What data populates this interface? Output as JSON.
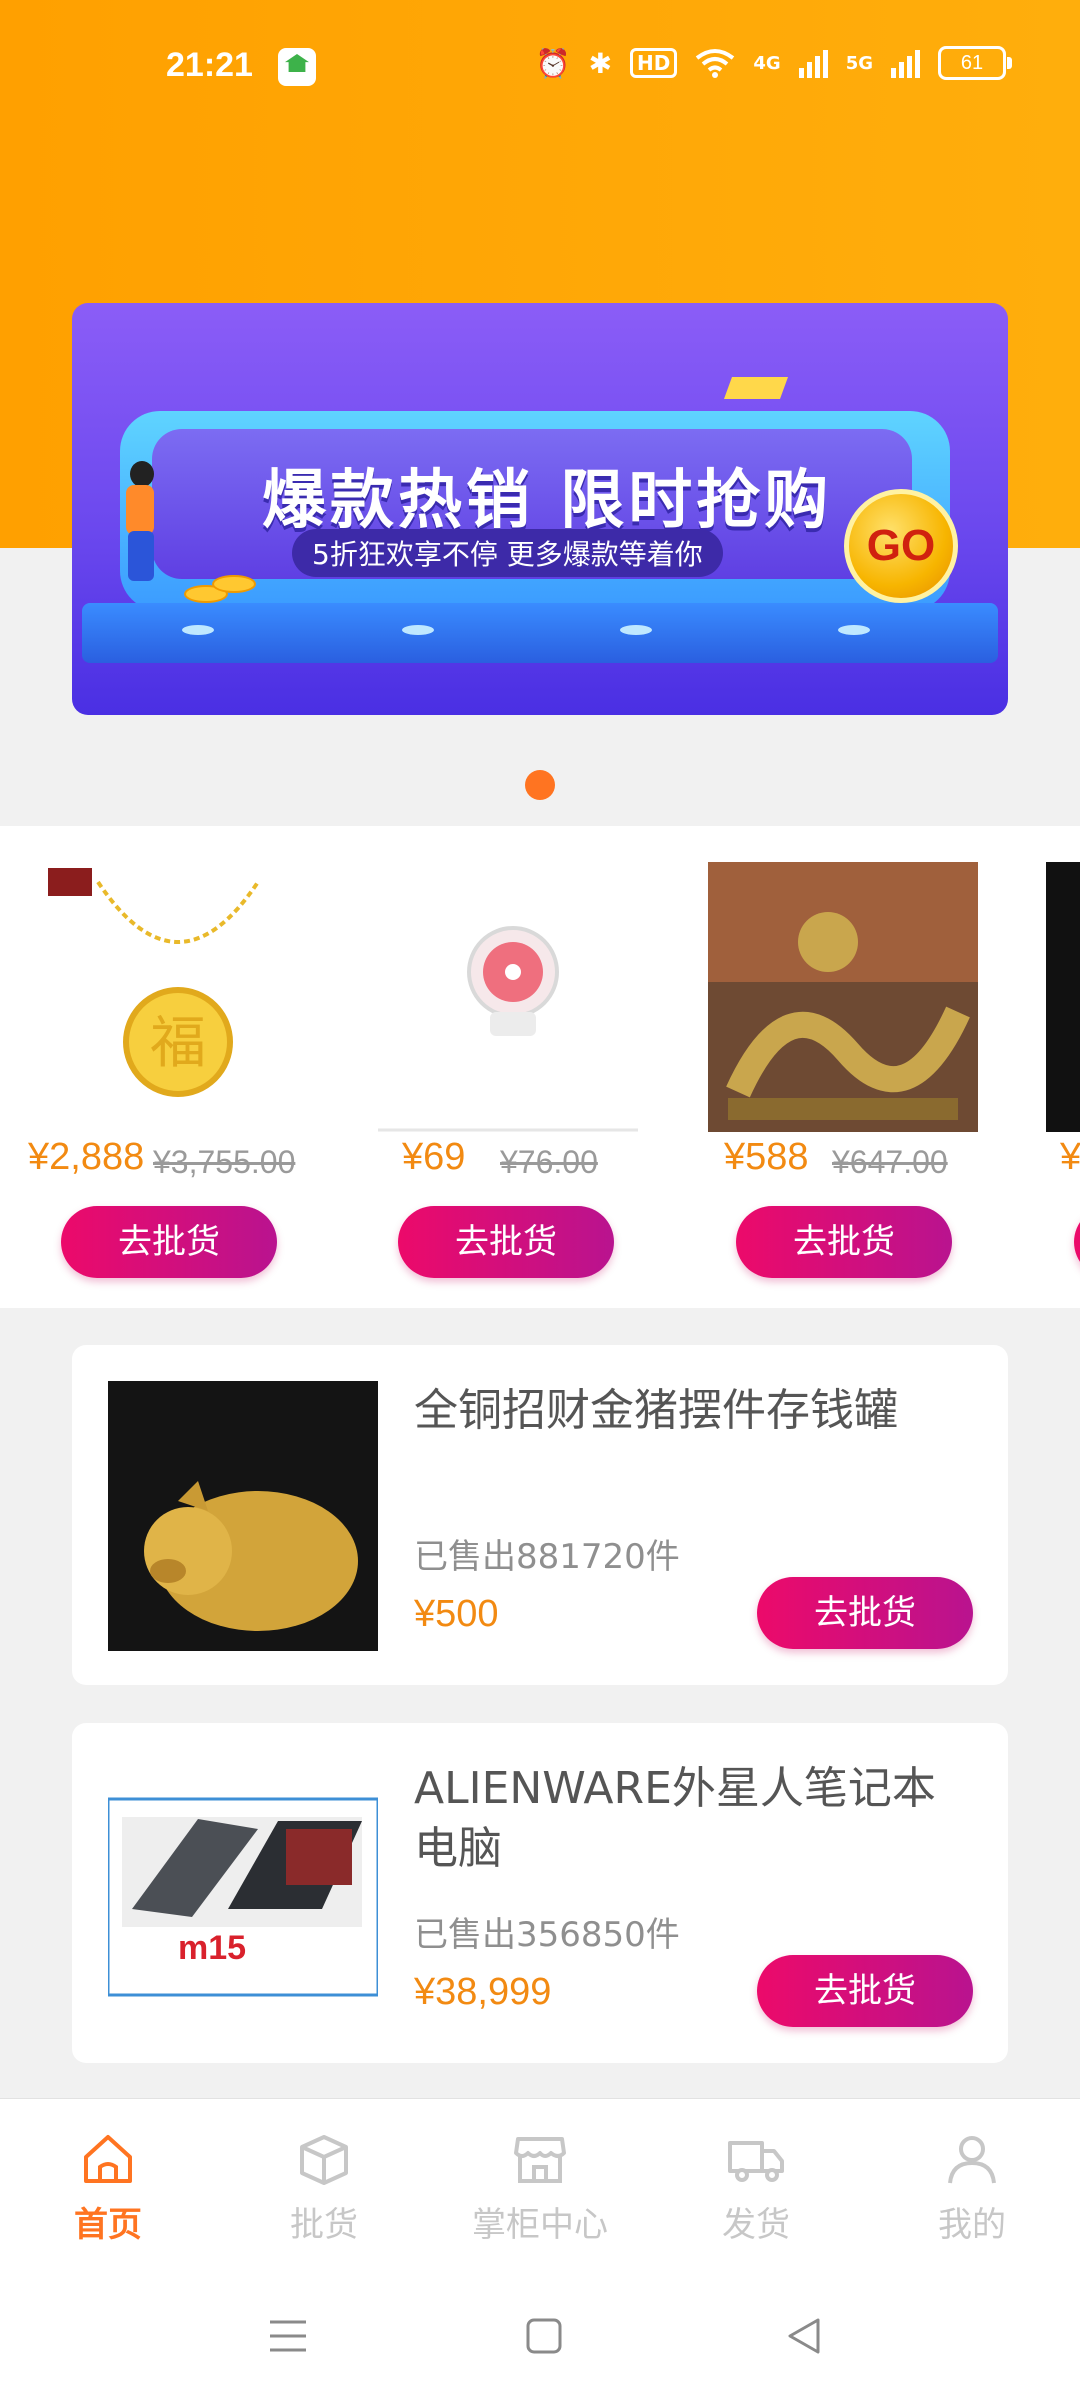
{
  "status_bar": {
    "time": "21:21",
    "battery": "61",
    "hd": "HD",
    "net1": "4G",
    "net2": "5G"
  },
  "banner": {
    "title": "爆款热销 限时抢购",
    "subtitle": "5折狂欢享不停 更多爆款等着你",
    "go": "GO"
  },
  "carousel": [
    {
      "price": "¥2,888",
      "original": "¥3,755.00",
      "button": "去批货",
      "image": "gold-necklace"
    },
    {
      "price": "¥69",
      "original": "¥76.00",
      "button": "去批货",
      "image": "desk-fan"
    },
    {
      "price": "¥588",
      "original": "¥647.00",
      "button": "去批货",
      "image": "brass-dragon"
    },
    {
      "price": "¥",
      "original": "",
      "button": "去批货",
      "image": "partial-product"
    }
  ],
  "list": [
    {
      "title": "全铜招财金猪摆件存钱罐",
      "sold": "已售出881720件",
      "price": "¥500",
      "button": "去批货",
      "image": "golden-pig"
    },
    {
      "title": "ALIENWARE外星人笔记本电脑",
      "sold": "已售出356850件",
      "price": "¥38,999",
      "button": "去批货",
      "image": "laptop"
    }
  ],
  "nav": [
    {
      "label": "首页",
      "icon": "home-icon",
      "active": true
    },
    {
      "label": "批货",
      "icon": "box-icon",
      "active": false
    },
    {
      "label": "掌柜中心",
      "icon": "store-icon",
      "active": false
    },
    {
      "label": "发货",
      "icon": "truck-icon",
      "active": false
    },
    {
      "label": "我的",
      "icon": "user-icon",
      "active": false
    }
  ],
  "colors": {
    "accent": "#ff7421",
    "price": "#f28a12",
    "button": "#ec0a6a",
    "top": "#ffa000"
  }
}
